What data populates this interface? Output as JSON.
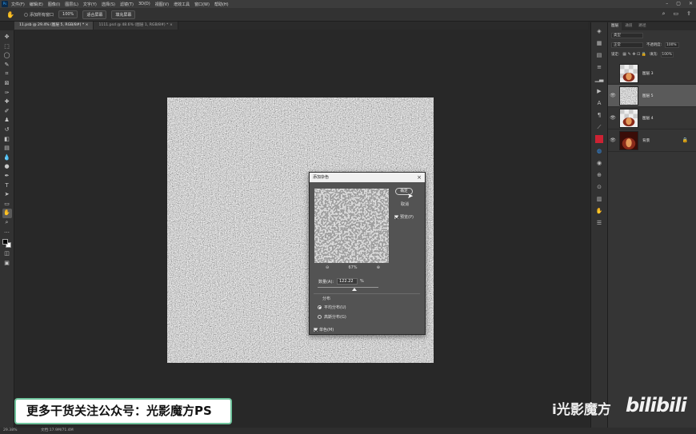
{
  "app": {
    "logo": "Ps"
  },
  "menu": [
    "文件(F)",
    "编辑(E)",
    "图像(I)",
    "图层(L)",
    "文字(Y)",
    "选择(S)",
    "滤镜(T)",
    "3D(D)",
    "视图(V)",
    "增效工具",
    "窗口(W)",
    "帮助(H)"
  ],
  "options": {
    "check_label": "添加所有窗口",
    "zoom": "100%",
    "fit_button": "适合屏幕",
    "fill_button": "填充屏幕"
  },
  "tabs": [
    {
      "label": "11.psb @ 29.4% (图层 5, RGB/8#) *",
      "active": true
    },
    {
      "label": "1111.psd @ 48.6% (图层 1, RGB/8#) *",
      "active": false
    }
  ],
  "dialog": {
    "title": "添加杂色",
    "ok": "确定",
    "cancel": "取消",
    "preview_label": "预览(P)",
    "zoom_level": "67%",
    "amount_label": "数量(A):",
    "amount_value": "122.22",
    "amount_unit": "%",
    "amount_slider": 0.61,
    "dist_group_label": "分布",
    "uniform_label": "平均分布(U)",
    "gaussian_label": "高斯分布(G)",
    "mono_label": "单色(M)"
  },
  "layers_panel": {
    "tabs": [
      "图层",
      "通道",
      "路径"
    ],
    "kind_label": "类型",
    "mode_label": "正常",
    "opacity_label": "不透明度:",
    "opacity_value": "100%",
    "lock_label": "锁定:",
    "fill_label": "填充:",
    "fill_value": "100%",
    "layers": [
      {
        "name": "图层 3",
        "visible": false,
        "selected": false
      },
      {
        "name": "图层 5",
        "visible": true,
        "selected": true
      },
      {
        "name": "图层 4",
        "visible": true,
        "selected": false
      },
      {
        "name": "背景",
        "visible": true,
        "selected": false,
        "locked": true
      }
    ]
  },
  "status": {
    "zoom": "29.38%",
    "doc": "文档:17.9M/71.4M"
  },
  "overlay": {
    "promo_text": "更多干货关注公众号：光影魔方PS",
    "watermark_text": "i光影魔方",
    "bili_logo": "bilibili"
  },
  "colors": {
    "noise_bg": "#9a9a9a",
    "dialog_bg": "#535353",
    "accent_green": "#6fc39c",
    "layer_thumb_red": "#8a2a1a"
  }
}
